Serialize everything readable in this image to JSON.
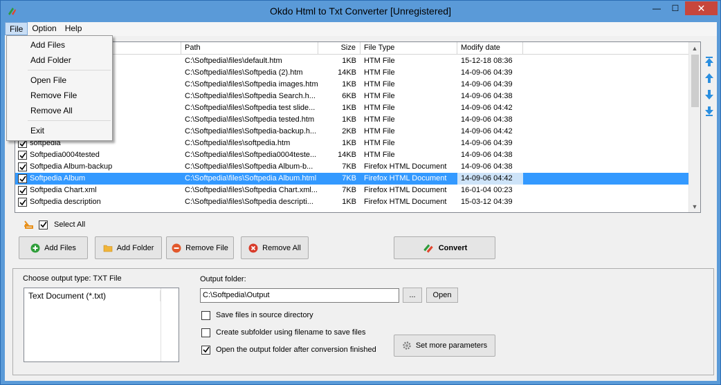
{
  "window": {
    "title": "Okdo Html to Txt Converter [Unregistered]",
    "minimize": "—",
    "maximize": "☐",
    "close": "✕"
  },
  "menu": {
    "file": "File",
    "option": "Option",
    "help": "Help"
  },
  "file_menu": {
    "add_files": "Add Files",
    "add_folder": "Add Folder",
    "open_file": "Open File",
    "remove_file": "Remove File",
    "remove_all": "Remove All",
    "exit": "Exit"
  },
  "columns": {
    "name": "",
    "path": "Path",
    "size": "Size",
    "type": "File Type",
    "date": "Modify date"
  },
  "rows": [
    {
      "name": "",
      "path": "C:\\Softpedia\\files\\default.htm",
      "size": "1KB",
      "type": "HTM File",
      "date": "15-12-18 08:36",
      "checked": true
    },
    {
      "name": "",
      "path": "C:\\Softpedia\\files\\Softpedia (2).htm",
      "size": "14KB",
      "type": "HTM File",
      "date": "14-09-06 04:39",
      "checked": true
    },
    {
      "name": "",
      "path": "C:\\Softpedia\\files\\Softpedia images.htm",
      "size": "1KB",
      "type": "HTM File",
      "date": "14-09-06 04:39",
      "checked": true
    },
    {
      "name": "",
      "path": "C:\\Softpedia\\files\\Softpedia Search.h...",
      "size": "6KB",
      "type": "HTM File",
      "date": "14-09-06 04:38",
      "checked": true
    },
    {
      "name": "",
      "path": "C:\\Softpedia\\files\\Softpedia test slide...",
      "size": "1KB",
      "type": "HTM File",
      "date": "14-09-06 04:42",
      "checked": true
    },
    {
      "name": "",
      "path": "C:\\Softpedia\\files\\Softpedia tested.htm",
      "size": "1KB",
      "type": "HTM File",
      "date": "14-09-06 04:38",
      "checked": true
    },
    {
      "name": "",
      "path": "C:\\Softpedia\\files\\Softpedia-backup.h...",
      "size": "2KB",
      "type": "HTM File",
      "date": "14-09-06 04:42",
      "checked": true
    },
    {
      "name": "softpedia",
      "path": "C:\\Softpedia\\files\\softpedia.htm",
      "size": "1KB",
      "type": "HTM File",
      "date": "14-09-06 04:39",
      "checked": true
    },
    {
      "name": "Softpedia0004tested",
      "path": "C:\\Softpedia\\files\\Softpedia0004teste...",
      "size": "14KB",
      "type": "HTM File",
      "date": "14-09-06 04:38",
      "checked": true
    },
    {
      "name": "Softpedia Album-backup",
      "path": "C:\\Softpedia\\files\\Softpedia Album-b...",
      "size": "7KB",
      "type": "Firefox HTML Document",
      "date": "14-09-06 04:38",
      "checked": true
    },
    {
      "name": "Softpedia Album",
      "path": "C:\\Softpedia\\files\\Softpedia Album.html",
      "size": "7KB",
      "type": "Firefox HTML Document",
      "date": "14-09-06 04:42",
      "checked": true,
      "selected": true
    },
    {
      "name": "Softpedia Chart.xml",
      "path": "C:\\Softpedia\\files\\Softpedia Chart.xml...",
      "size": "7KB",
      "type": "Firefox HTML Document",
      "date": "16-01-04 00:23",
      "checked": true
    },
    {
      "name": "Softpedia description",
      "path": "C:\\Softpedia\\files\\Softpedia descripti...",
      "size": "1KB",
      "type": "Firefox HTML Document",
      "date": "15-03-12 04:39",
      "checked": true
    }
  ],
  "select_all": {
    "label": "Select All",
    "checked": true
  },
  "buttons": {
    "add_files": "Add Files",
    "add_folder": "Add Folder",
    "remove_file": "Remove File",
    "remove_all": "Remove All",
    "convert": "Convert"
  },
  "output": {
    "type_label": "Choose output type:  TXT File",
    "types": [
      "Text Document (*.txt)"
    ],
    "folder_label": "Output folder:",
    "folder_value": "C:\\Softpedia\\Output",
    "browse": "...",
    "open": "Open",
    "opt_source_dir": "Save files in source directory",
    "opt_source_dir_checked": false,
    "opt_subfolder": "Create subfolder using filename to save files",
    "opt_subfolder_checked": false,
    "opt_open_after": "Open the output folder after conversion finished",
    "opt_open_after_checked": true,
    "more_params": "Set more parameters"
  },
  "colors": {
    "selection": "#3399ff",
    "title_bar": "#5a9ad8",
    "close": "#c7463c",
    "arrow_blue": "#2b8fe0"
  }
}
